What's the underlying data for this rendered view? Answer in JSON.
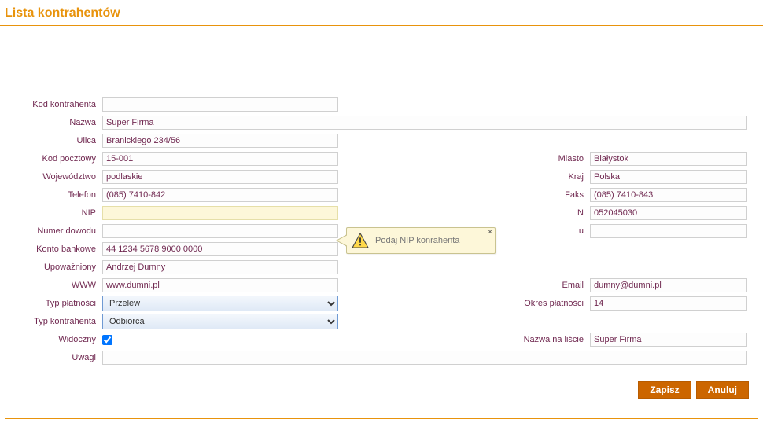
{
  "title": "Lista kontrahentów",
  "labels": {
    "kod_kontrahenta": "Kod kontrahenta",
    "nazwa": "Nazwa",
    "ulica": "Ulica",
    "kod_pocztowy": "Kod pocztowy",
    "miasto": "Miasto",
    "wojewodztwo": "Województwo",
    "kraj": "Kraj",
    "telefon": "Telefon",
    "faks": "Faks",
    "nip": "NIP",
    "regon_obscured": "N",
    "numer_dowodu": "Numer dowodu",
    "pesel_obscured": "u",
    "konto_bankowe": "Konto bankowe",
    "upowazniony": "Upoważniony",
    "www": "WWW",
    "email": "Email",
    "typ_platnosci": "Typ płatności",
    "okres_platnosci": "Okres płatności",
    "typ_kontrahenta": "Typ kontrahenta",
    "widoczny": "Widoczny",
    "nazwa_na_liscie": "Nazwa na liście",
    "uwagi": "Uwagi"
  },
  "values": {
    "kod_kontrahenta": "",
    "nazwa": "Super Firma",
    "ulica": "Branickiego 234/56",
    "kod_pocztowy": "15-001",
    "miasto": "Białystok",
    "wojewodztwo": "podlaskie",
    "kraj": "Polska",
    "telefon": "(085) 7410-842",
    "faks": "(085) 7410-843",
    "nip": "",
    "regon": "052045030",
    "numer_dowodu": "",
    "konto_bankowe": "44 1234 5678 9000 0000",
    "upowazniony": "Andrzej Dumny",
    "www": "www.dumni.pl",
    "email": "dumny@dumni.pl",
    "typ_platnosci": "Przelew",
    "okres_platnosci": "14",
    "typ_kontrahenta": "Odbiorca",
    "widoczny": true,
    "nazwa_na_liscie": "Super Firma",
    "uwagi": ""
  },
  "tooltip": {
    "text": "Podaj NIP konrahenta",
    "close": "×"
  },
  "buttons": {
    "save": "Zapisz",
    "cancel": "Anuluj"
  }
}
